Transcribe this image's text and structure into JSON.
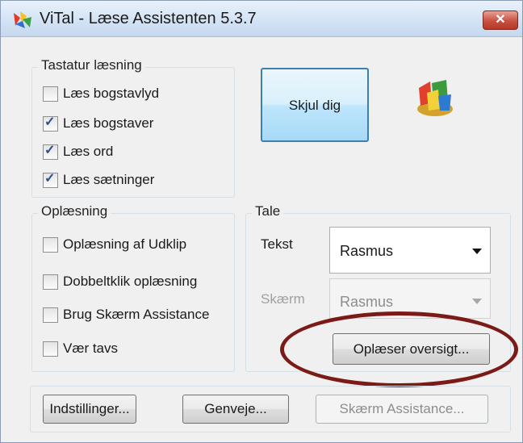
{
  "window": {
    "title": "ViTal - Læse Assistenten 5.3.7",
    "close_label": "✕"
  },
  "tastatur": {
    "title": "Tastatur læsning",
    "items": [
      {
        "label": "Læs bogstavlyd",
        "checked": false
      },
      {
        "label": "Læs bogstaver",
        "checked": true
      },
      {
        "label": "Læs ord",
        "checked": true
      },
      {
        "label": "Læs sætninger",
        "checked": true
      }
    ]
  },
  "skjul_button": "Skjul dig",
  "oplaesning": {
    "title": "Oplæsning",
    "items": [
      {
        "label": "Oplæsning af Udklip",
        "checked": false
      },
      {
        "label": "Dobbeltklik oplæsning",
        "checked": false
      },
      {
        "label": "Brug Skærm Assistance",
        "checked": false
      },
      {
        "label": "Vær tavs",
        "checked": false
      }
    ]
  },
  "tale": {
    "title": "Tale",
    "tekst_label": "Tekst",
    "tekst_value": "Rasmus",
    "skaerm_label": "Skærm",
    "skaerm_value": "Rasmus",
    "overview_button": "Oplæser oversigt..."
  },
  "footer": {
    "settings_button": "Indstillinger...",
    "shortcuts_button": "Genveje...",
    "screen_assist_button": "Skærm Assistance..."
  },
  "colors": {
    "highlight_ellipse": "#7b1a17",
    "close_button": "#c9503e"
  }
}
